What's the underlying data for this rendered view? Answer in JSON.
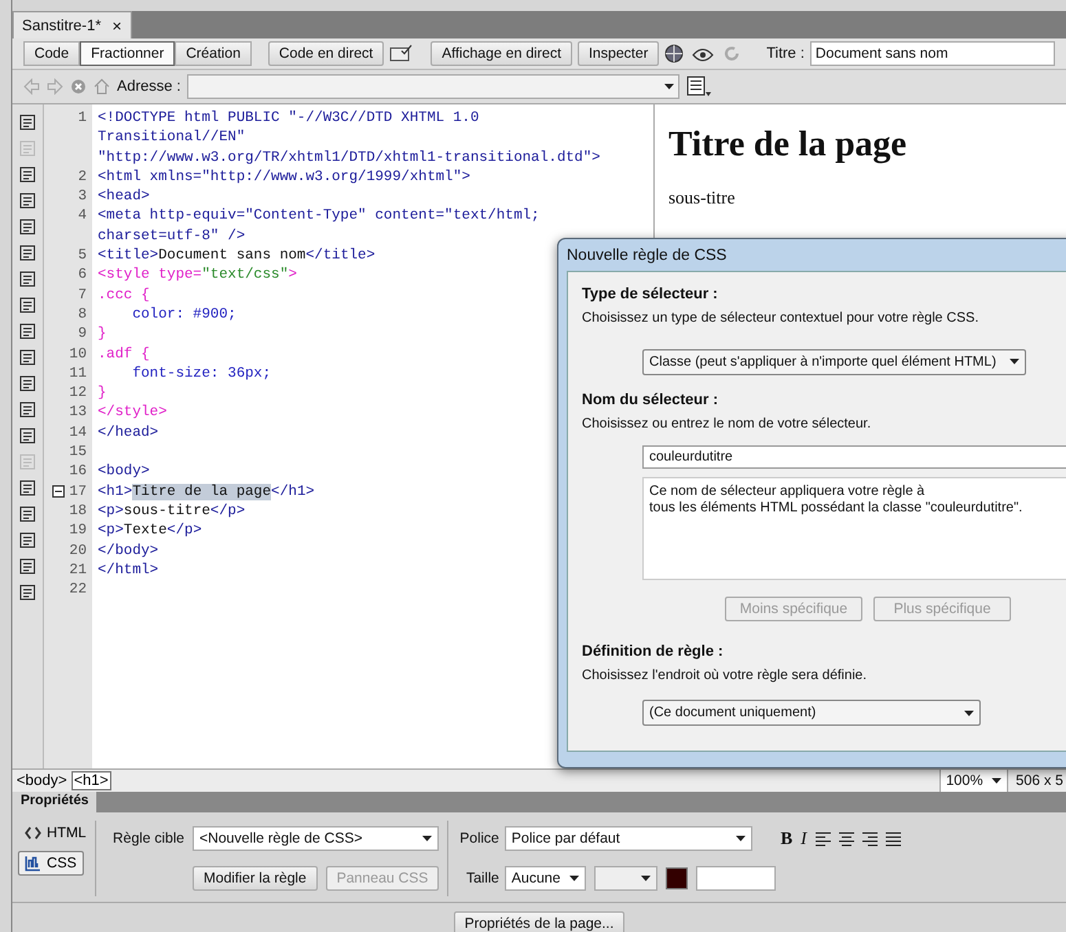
{
  "document_tab": {
    "title": "Sanstitre-1*",
    "close": "×"
  },
  "toolbar": {
    "view_buttons": [
      {
        "label": "Code",
        "selected": false
      },
      {
        "label": "Fractionner",
        "selected": true
      },
      {
        "label": "Création",
        "selected": false
      }
    ],
    "live_code": "Code en direct",
    "live_view": "Affichage en direct",
    "inspect": "Inspecter",
    "title_label": "Titre :",
    "title_value": "Document sans nom"
  },
  "address_bar": {
    "label": "Adresse :"
  },
  "code_lines": [
    {
      "number": "1",
      "segments": [
        {
          "text": "<!DOCTYPE html PUBLIC \"-//W3C//DTD XHTML 1.0",
          "kind": "tag"
        }
      ]
    },
    {
      "segments": [
        {
          "text": "Transitional//EN\"",
          "kind": "tag"
        }
      ]
    },
    {
      "segments": [
        {
          "text": "\"http://www.w3.org/TR/xhtml1/DTD/xhtml1-transitional.dtd\">",
          "kind": "tag"
        }
      ]
    },
    {
      "number": "2",
      "segments": [
        {
          "text": "<html xmlns=\"http://www.w3.org/1999/xhtml\">",
          "kind": "tag"
        }
      ]
    },
    {
      "number": "3",
      "segments": [
        {
          "text": "<head>",
          "kind": "tag"
        }
      ]
    },
    {
      "number": "4",
      "segments": [
        {
          "text": "<meta http-equiv=\"Content-Type\" content=\"text/html;",
          "kind": "tag"
        }
      ]
    },
    {
      "segments": [
        {
          "text": "charset=utf-8\" />",
          "kind": "tag"
        }
      ]
    },
    {
      "number": "5",
      "segments": [
        {
          "text": "<title>",
          "kind": "tag"
        },
        {
          "text": "Document sans nom",
          "kind": "text"
        },
        {
          "text": "</title>",
          "kind": "tag"
        }
      ]
    },
    {
      "number": "6",
      "segments": [
        {
          "text": "<style type=",
          "kind": "css"
        },
        {
          "text": "\"text/css\"",
          "kind": "string"
        },
        {
          "text": ">",
          "kind": "css"
        }
      ]
    },
    {
      "number": "7",
      "segments": [
        {
          "text": ".ccc {",
          "kind": "css"
        }
      ]
    },
    {
      "number": "8",
      "segments": [
        {
          "text": "    color: #900;",
          "kind": "value"
        }
      ]
    },
    {
      "number": "9",
      "segments": [
        {
          "text": "}",
          "kind": "css"
        }
      ]
    },
    {
      "number": "10",
      "segments": [
        {
          "text": ".adf {",
          "kind": "css"
        }
      ]
    },
    {
      "number": "11",
      "segments": [
        {
          "text": "    font-size: 36px;",
          "kind": "value"
        }
      ]
    },
    {
      "number": "12",
      "segments": [
        {
          "text": "}",
          "kind": "css"
        }
      ]
    },
    {
      "number": "13",
      "segments": [
        {
          "text": "</style>",
          "kind": "css"
        }
      ]
    },
    {
      "number": "14",
      "segments": [
        {
          "text": "</head>",
          "kind": "tag"
        }
      ]
    },
    {
      "number": "15"
    },
    {
      "number": "16",
      "segments": [
        {
          "text": "<body>",
          "kind": "tag"
        }
      ]
    },
    {
      "number": "17",
      "foldable": true,
      "segments": [
        {
          "text": "<h1>",
          "kind": "tag"
        },
        {
          "text": "Titre de la page",
          "kind": "selected"
        },
        {
          "text": "</h1>",
          "kind": "tag"
        }
      ]
    },
    {
      "number": "18",
      "segments": [
        {
          "text": "<p>",
          "kind": "tag"
        },
        {
          "text": "sous-titre",
          "kind": "text"
        },
        {
          "text": "</p>",
          "kind": "tag"
        }
      ]
    },
    {
      "number": "19",
      "segments": [
        {
          "text": "<p>",
          "kind": "tag"
        },
        {
          "text": "Texte",
          "kind": "text"
        },
        {
          "text": "</p>",
          "kind": "tag"
        }
      ]
    },
    {
      "number": "20",
      "segments": [
        {
          "text": "</body>",
          "kind": "tag"
        }
      ]
    },
    {
      "number": "21",
      "segments": [
        {
          "text": "</html>",
          "kind": "tag"
        }
      ]
    },
    {
      "number": "22"
    }
  ],
  "preview": {
    "heading": "Titre de la page",
    "subtitle": "sous-titre"
  },
  "tag_selector": [
    {
      "label": "<body>",
      "selected": false
    },
    {
      "label": "<h1>",
      "selected": true
    }
  ],
  "status": {
    "zoom": "100%",
    "size": "506 x 5"
  },
  "dialog": {
    "title": "Nouvelle règle de CSS",
    "selector_type": {
      "heading": "Type de sélecteur :",
      "hint": "Choisissez un type de sélecteur contextuel pour votre règle CSS.",
      "value": "Classe (peut s'appliquer à n'importe quel élément HTML)"
    },
    "selector_name": {
      "heading": "Nom du sélecteur :",
      "hint": "Choisissez ou entrez le nom de votre sélecteur.",
      "value": "couleurdutitre",
      "description": [
        "Ce nom de sélecteur appliquera votre règle à",
        "tous les éléments HTML possédant la classe \"couleurdutitre\"."
      ]
    },
    "buttons": [
      {
        "label": "Moins spécifique",
        "disabled": true
      },
      {
        "label": "Plus spécifique",
        "disabled": true
      }
    ],
    "rule_definition": {
      "heading": "Définition de règle :",
      "hint": "Choisissez l'endroit où votre règle sera définie.",
      "value": "(Ce document uniquement)"
    }
  },
  "properties": {
    "tab": "Propriétés",
    "modes": [
      {
        "label": "HTML",
        "selected": false
      },
      {
        "label": "CSS",
        "selected": true
      }
    ],
    "target_rule_label": "Règle cible",
    "target_rule": "<Nouvelle règle de CSS>",
    "edit_rule": {
      "label": "Modifier la règle",
      "disabled": false
    },
    "css_panel": {
      "label": "Panneau CSS",
      "disabled": true
    },
    "font_label": "Police",
    "font": "Police par défaut",
    "size_label": "Taille",
    "size": "Aucune",
    "bold": "B",
    "italic": "I",
    "page_properties": "Propriétés de la page..."
  }
}
